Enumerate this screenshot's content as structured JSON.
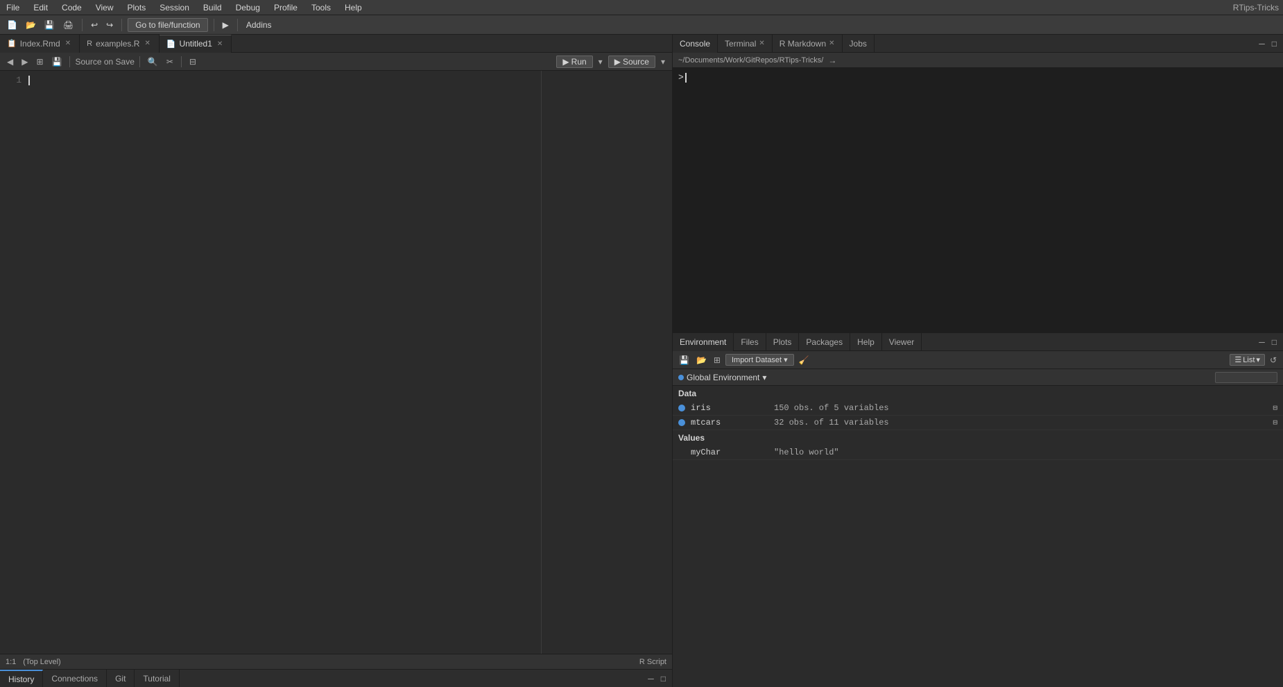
{
  "menubar": {
    "items": [
      "File",
      "Edit",
      "Code",
      "View",
      "Plots",
      "Session",
      "Build",
      "Debug",
      "Profile",
      "Tools",
      "Help"
    ]
  },
  "toolbar": {
    "go_to_file": "Go to file/function",
    "addins": "Addins",
    "rtips_label": "RTips-Tricks"
  },
  "editor": {
    "tabs": [
      {
        "id": "index",
        "label": "Index.Rmd",
        "active": false,
        "closeable": true
      },
      {
        "id": "examples",
        "label": "examples.R",
        "active": false,
        "closeable": true
      },
      {
        "id": "untitled1",
        "label": "Untitled1",
        "active": true,
        "closeable": true
      }
    ],
    "source_on_save": "Source on Save",
    "run_label": "Run",
    "source_label": "Source",
    "line_number": "1",
    "cursor_pos": "1:1",
    "level": "(Top Level)",
    "script_type": "R Script"
  },
  "console": {
    "tabs": [
      {
        "id": "console",
        "label": "Console",
        "active": true,
        "closeable": false
      },
      {
        "id": "terminal",
        "label": "Terminal",
        "active": false,
        "closeable": true
      },
      {
        "id": "rmarkdown",
        "label": "R Markdown",
        "active": false,
        "closeable": true
      },
      {
        "id": "jobs",
        "label": "Jobs",
        "active": false,
        "closeable": false
      }
    ],
    "path": "~/Documents/Work/GitRepos/RTips-Tricks/",
    "prompt": ">"
  },
  "environment": {
    "tabs": [
      {
        "id": "environment",
        "label": "Environment",
        "active": true
      },
      {
        "id": "files",
        "label": "Files",
        "active": false
      },
      {
        "id": "plots",
        "label": "Plots",
        "active": false
      },
      {
        "id": "packages",
        "label": "Packages",
        "active": false
      },
      {
        "id": "help",
        "label": "Help",
        "active": false
      },
      {
        "id": "viewer",
        "label": "Viewer",
        "active": false
      }
    ],
    "global_env_label": "Global Environment",
    "list_view_label": "List",
    "import_dataset": "Import Dataset",
    "data_section": "Data",
    "values_section": "Values",
    "data_items": [
      {
        "name": "iris",
        "desc": "150 obs. of 5 variables"
      },
      {
        "name": "mtcars",
        "desc": "32 obs. of 11 variables"
      }
    ],
    "values_items": [
      {
        "name": "myChar",
        "desc": "\"hello world\""
      }
    ]
  },
  "bottom_tabs": {
    "tabs": [
      {
        "id": "history",
        "label": "History",
        "active": true
      },
      {
        "id": "connections",
        "label": "Connections",
        "active": false
      },
      {
        "id": "git",
        "label": "Git",
        "active": false
      },
      {
        "id": "tutorial",
        "label": "Tutorial",
        "active": false
      }
    ]
  },
  "icons": {
    "back": "◀",
    "forward": "▶",
    "save": "💾",
    "new_file": "📄",
    "open": "📂",
    "close": "✕",
    "settings": "⚙",
    "refresh": "↺",
    "chevron_down": "▾",
    "grid": "⊞",
    "list": "☰",
    "search": "🔍",
    "minimize": "─",
    "maximize": "□",
    "arrow_right": "→",
    "broom": "🧹",
    "table": "⊟",
    "scroll": "↕"
  }
}
